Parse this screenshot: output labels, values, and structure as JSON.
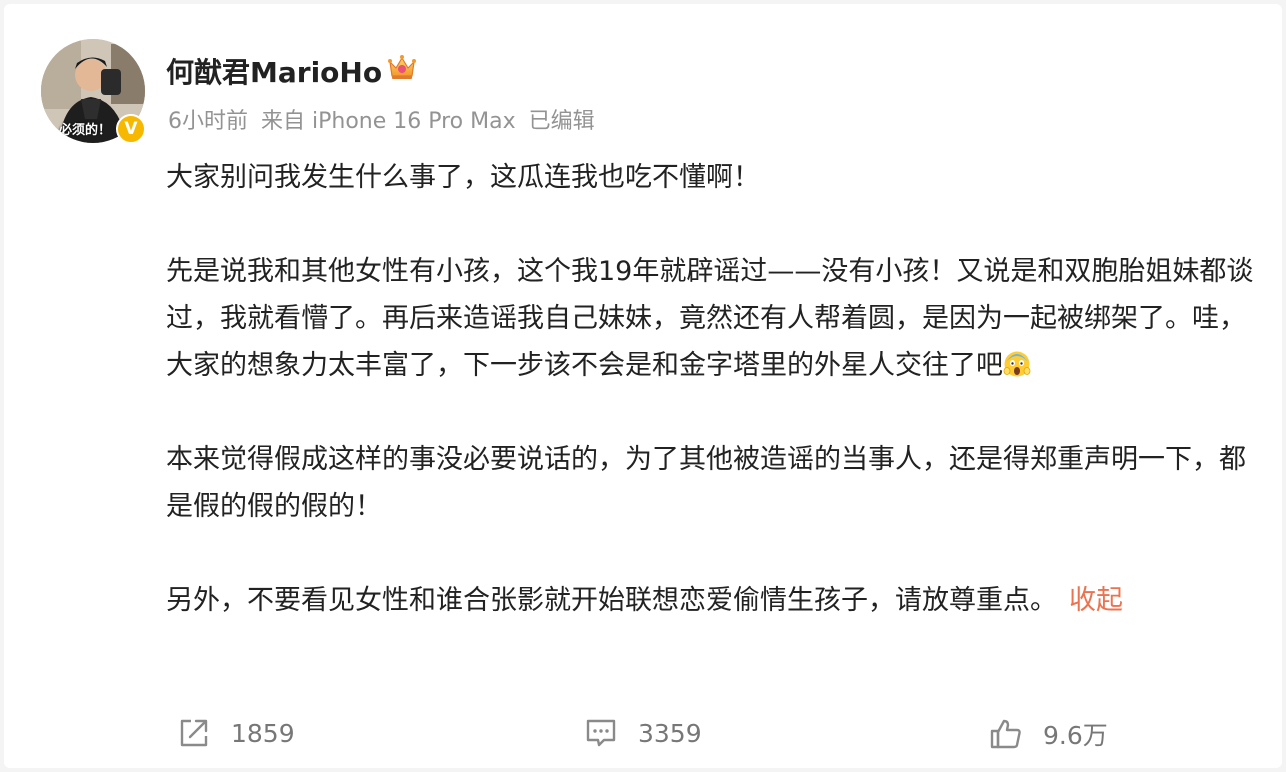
{
  "post": {
    "author": {
      "name": "何猷君MarioHo",
      "avatar_caption": "必须的！",
      "verified_icon": "verified-badge-icon",
      "verified_color": "#f6b800",
      "member_icon": "crown-icon"
    },
    "meta": {
      "time": "6小时前",
      "source": "来自 iPhone 16 Pro Max",
      "edited": "已编辑"
    },
    "paragraphs": {
      "p1": "大家别问我发生什么事了，这瓜连我也吃不懂啊！",
      "p2": "先是说我和其他女性有小孩，这个我19年就辟谣过——没有小孩！又说是和双胞胎姐妹都谈过，我就看懵了。再后来造谣我自己妹妹，竟然还有人帮着圆，是因为一起被绑架了。哇，大家的想象力太丰富了，下一步该不会是和金字塔里的外星人交往了吧",
      "p2_emoji": "scream-emoji-icon",
      "p3": "本来觉得假成这样的事没必要说话的，为了其他被造谣的当事人，还是得郑重声明一下，都是假的假的假的！",
      "p4": "另外，不要看见女性和谁合张影就开始联想恋爱偷情生孩子，请放尊重点。"
    },
    "collapse_label": "收起",
    "link_color": "#eb7350"
  },
  "actions": {
    "repost": {
      "icon": "repost-icon",
      "count": "1859"
    },
    "comment": {
      "icon": "comment-icon",
      "count": "3359"
    },
    "like": {
      "icon": "thumbs-up-icon",
      "count": "9.6万"
    }
  }
}
